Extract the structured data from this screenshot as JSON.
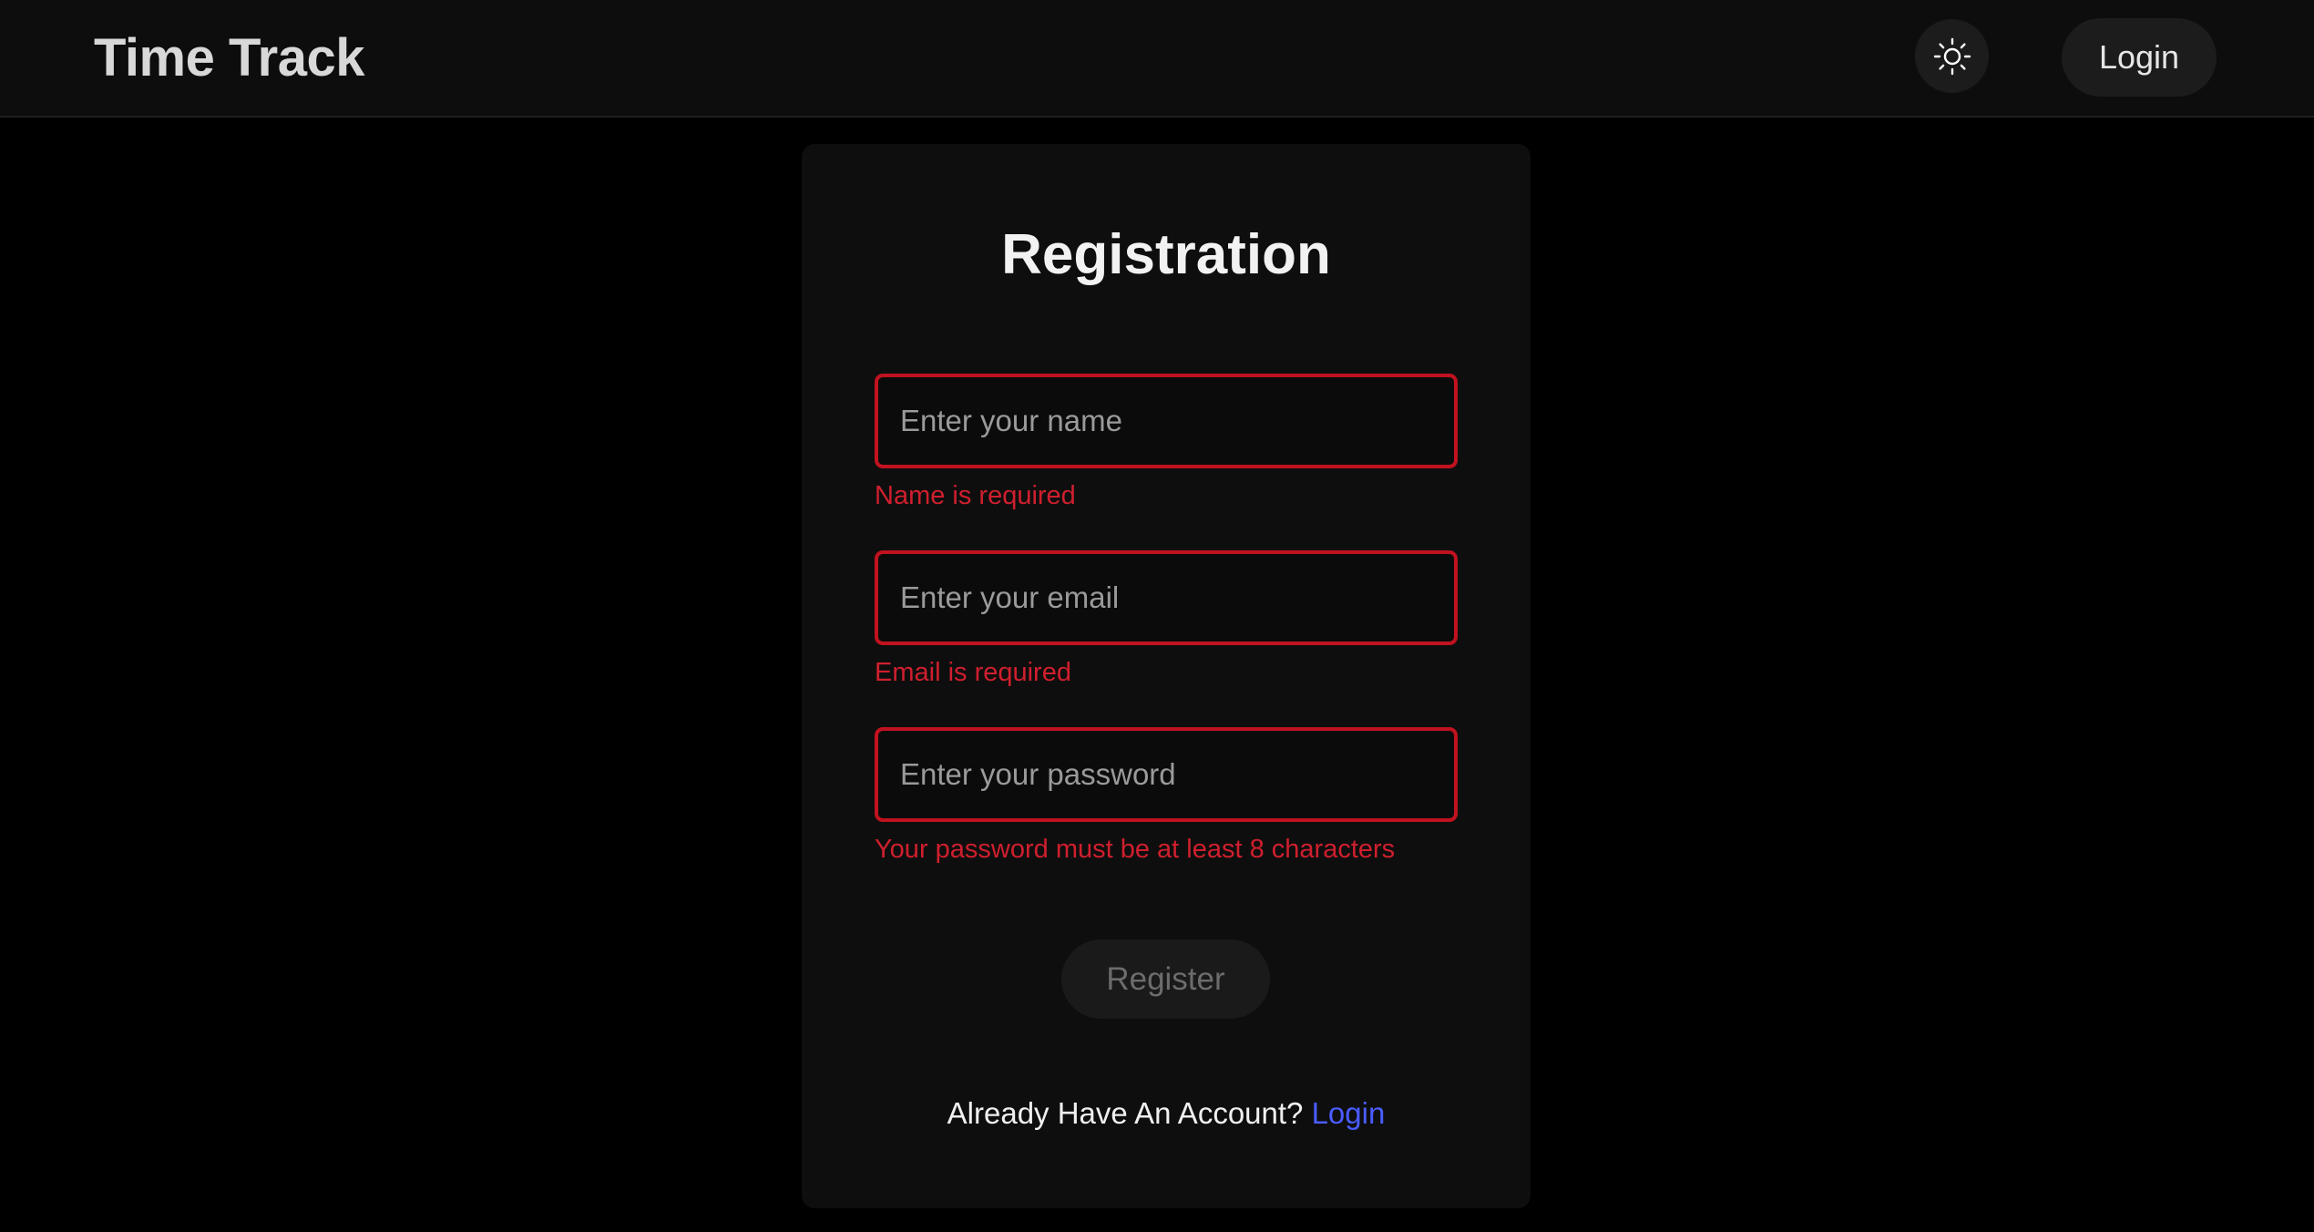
{
  "header": {
    "brand": "Time Track",
    "theme_toggle_icon": "sun-icon",
    "login_label": "Login"
  },
  "form": {
    "title": "Registration",
    "name": {
      "placeholder": "Enter your name",
      "value": "",
      "error": "Name is required"
    },
    "email": {
      "placeholder": "Enter your email",
      "value": "",
      "error": "Email is required"
    },
    "password": {
      "placeholder": "Enter your password",
      "value": "",
      "error": "Your password must be at least 8 characters"
    },
    "register_label": "Register",
    "footer_prompt": "Already Have An Account?",
    "footer_link": "Login"
  },
  "colors": {
    "background": "#000000",
    "card": "#0e0e0e",
    "error": "#cf1f2e",
    "link": "#4a5cff"
  }
}
